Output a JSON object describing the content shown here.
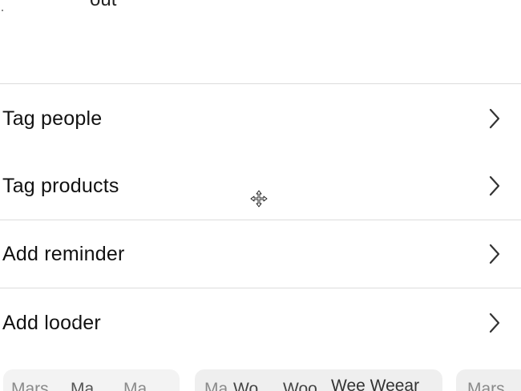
{
  "header": {
    "fragment_text": "out"
  },
  "options": [
    {
      "label": "Tag people",
      "icon": "chevron-right-icon"
    },
    {
      "label": "Tag products",
      "icon": "chevron-right-icon"
    },
    {
      "label": "Add reminder",
      "icon": "chevron-right-icon"
    },
    {
      "label": "Add looder",
      "icon": "chevron-right-icon"
    }
  ],
  "chips": [
    {
      "text_a": "Mars",
      "text_b": "Ma",
      "text_c": "Ma"
    },
    {
      "text_a": "Ma",
      "text_b": "Wo",
      "text_c": "Woo",
      "text_d": "Wee Weear"
    },
    {
      "text_a": "Mars"
    }
  ],
  "cursor": {
    "icon": "move-cursor-icon"
  },
  "colors": {
    "divider": "#dcdcdc",
    "text": "#111111",
    "chip_bg": "#efefef",
    "chip_text": "#8a8a8a"
  }
}
